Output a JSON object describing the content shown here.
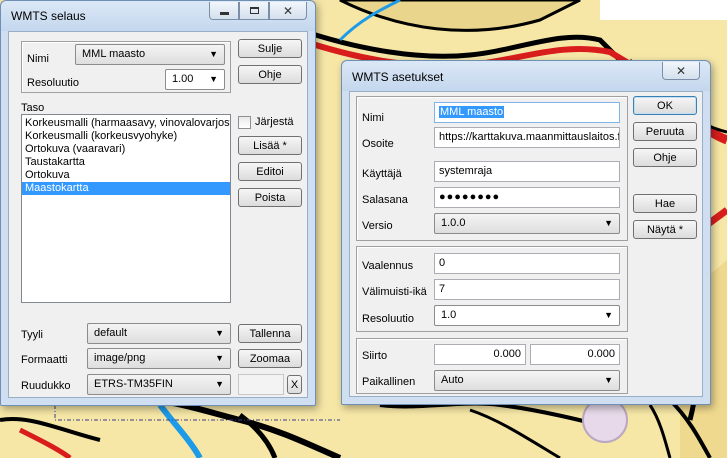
{
  "selaus": {
    "title": "WMTS selaus",
    "nimi_label": "Nimi",
    "nimi_value": "MML maasto",
    "resoluutio_label": "Resoluutio",
    "resoluutio_value": "1.00",
    "sulje": "Sulje",
    "ohje": "Ohje",
    "taso_label": "Taso",
    "layers": [
      "Korkeusmalli (harmaasavy, vinovalovarjostus)",
      "Korkeusmalli (korkeusvyohyke)",
      "Ortokuva (vaaravari)",
      "Taustakartta",
      "Ortokuva",
      "Maastokartta"
    ],
    "selected_layer": "Maastokartta",
    "jarjesta": "Järjestä",
    "lisaa": "Lisää *",
    "editoi": "Editoi",
    "poista": "Poista",
    "tyyli_label": "Tyyli",
    "tyyli_value": "default",
    "formaatti_label": "Formaatti",
    "formaatti_value": "image/png",
    "ruudukko_label": "Ruudukko",
    "ruudukko_value": "ETRS-TM35FIN",
    "tallenna": "Tallenna",
    "zoomaa": "Zoomaa",
    "x_button": "X"
  },
  "asetukset": {
    "title": "WMTS asetukset",
    "nimi_label": "Nimi",
    "nimi_value": "MML maasto",
    "osoite_label": "Osoite",
    "osoite_value": "https://karttakuva.maanmittauslaitos.fi",
    "kayttaja_label": "Käyttäjä",
    "kayttaja_value": "systemraja",
    "salasana_label": "Salasana",
    "salasana_value": "●●●●●●●●",
    "versio_label": "Versio",
    "versio_value": "1.0.0",
    "vaalennus_label": "Vaalennus",
    "vaalennus_value": "0",
    "valimuisti_label": "Välimuisti-ikä",
    "valimuisti_value": "7",
    "resoluutio_label": "Resoluutio",
    "resoluutio_value": "1.0",
    "siirto_label": "Siirto",
    "siirto_x": "0.000",
    "siirto_y": "0.000",
    "paikallinen_label": "Paikallinen",
    "paikallinen_value": "Auto",
    "ok": "OK",
    "peruuta": "Peruuta",
    "ohje": "Ohje",
    "hae": "Hae",
    "nayta": "Näytä *"
  },
  "colors": {
    "map_base": "#f6e7a6",
    "map_red": "#d91d1d",
    "map_blue": "#1e9be8",
    "selection": "#3399ff",
    "window_frame": "#cfdff1"
  }
}
